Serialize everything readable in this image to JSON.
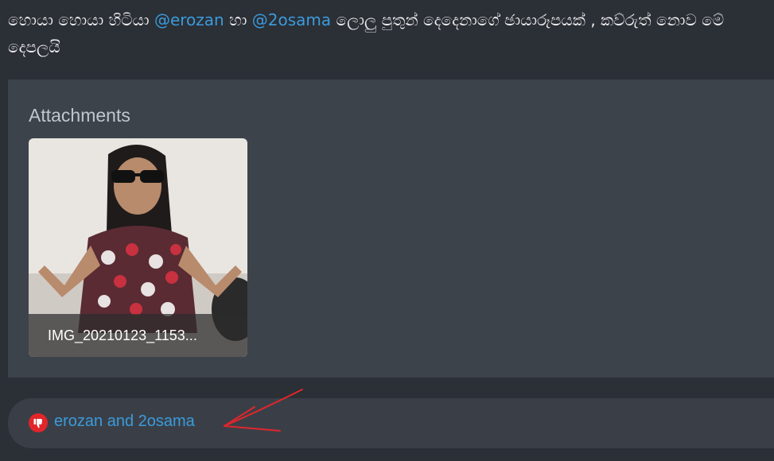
{
  "post": {
    "text_1": "හොයා හොයා හිටියා ",
    "mention_1": "@erozan",
    "text_2": " හා ",
    "mention_2": "@2osama",
    "text_3": " ලොලු පුතුන් දෙදෙනාගේ ඡායාරූපයක් , කව්රුත් නොව මේ දෙපලයි"
  },
  "attachments": {
    "title": "Attachments",
    "items": [
      {
        "filename": "IMG_20210123_1153...",
        "icon": "photo-thumbnail"
      }
    ]
  },
  "reactions": {
    "icon": "thumbs-down-icon",
    "icon_color": "#e0262b",
    "users": "erozan and 2osama"
  },
  "annotation": {
    "color": "#e0262b"
  }
}
